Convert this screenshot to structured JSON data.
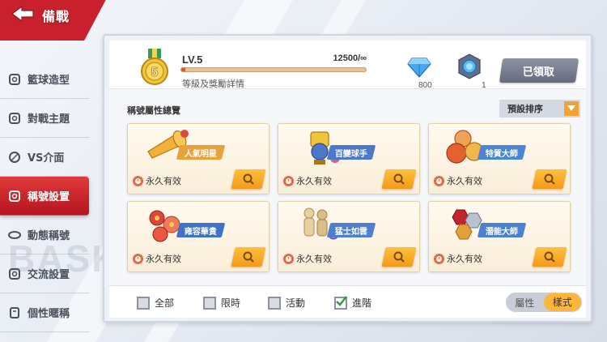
{
  "header": {
    "title": "備戰"
  },
  "sidebar": {
    "items": [
      {
        "label": "籃球造型",
        "icon": "basketball-icon",
        "active": false
      },
      {
        "label": "對戰主題",
        "icon": "theme-icon",
        "active": false
      },
      {
        "label": "VS介面",
        "icon": "vs-icon",
        "active": false
      },
      {
        "label": "稱號設置",
        "icon": "title-icon",
        "active": true
      },
      {
        "label": "動態稱號",
        "icon": "dynamic-title-icon",
        "active": false
      },
      {
        "label": "交流設置",
        "icon": "chat-icon",
        "active": false
      },
      {
        "label": "個性暱稱",
        "icon": "nickname-icon",
        "active": false
      }
    ]
  },
  "watermark": "BASK",
  "level": {
    "medal_number": "5",
    "label": "LV.5",
    "exp_text": "12500/∞",
    "exp_progress": 0.02,
    "reward_link": "等級及獎勵詳情"
  },
  "currency": {
    "diamond_count": "800",
    "token_count": "1"
  },
  "claim_button": "已領取",
  "overview": {
    "title": "稱號屬性總覽",
    "sort_label": "預設排序"
  },
  "cards": [
    {
      "name": "人氣明星",
      "validity": "永久有效",
      "banner_color": "#e9a23a",
      "art": "trumpet"
    },
    {
      "name": "百變球手",
      "validity": "永久有效",
      "banner_color": "#4b78c9",
      "art": "trophy"
    },
    {
      "name": "特質大師",
      "validity": "永久有效",
      "banner_color": "#4a86d4",
      "art": "balls"
    },
    {
      "name": "雍容華貴",
      "validity": "永久有效",
      "banner_color": "#3f73c7",
      "art": "flowers"
    },
    {
      "name": "猛士如雲",
      "validity": "永久有效",
      "banner_color": "#4c7fd0",
      "art": "figures"
    },
    {
      "name": "潛能大師",
      "validity": "永久有效",
      "banner_color": "#4a82cf",
      "art": "hexagons"
    }
  ],
  "filters": [
    {
      "label": "全部",
      "checked": false
    },
    {
      "label": "限時",
      "checked": false
    },
    {
      "label": "活動",
      "checked": false
    },
    {
      "label": "進階",
      "checked": true
    }
  ],
  "view_toggle": {
    "options": [
      "屬性",
      "樣式"
    ],
    "selected": "樣式"
  },
  "colors": {
    "accent_red": "#c8202d",
    "accent_orange": "#f39a1c",
    "card_bg": "#fbeed8"
  }
}
